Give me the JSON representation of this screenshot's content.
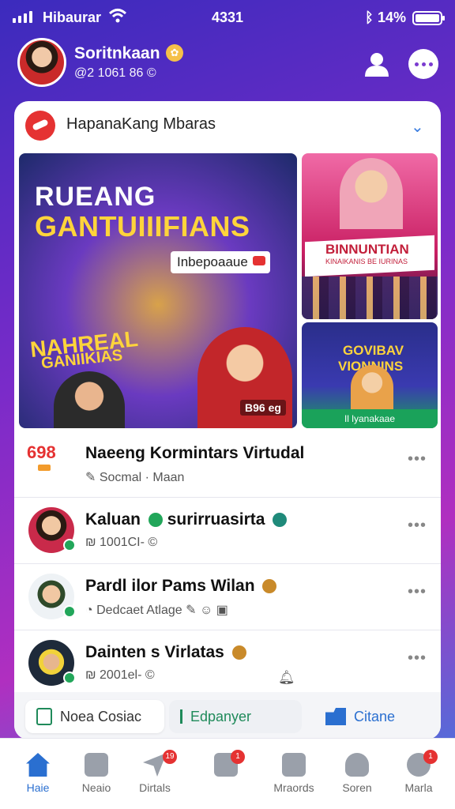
{
  "status": {
    "carrier": "Hibaurar",
    "time": "4331",
    "battery": "14%"
  },
  "profile": {
    "name": "Soritnkaan",
    "meta": "@2 1061 86 ©"
  },
  "card": {
    "title": "HapanaKang Mbaras"
  },
  "banners": {
    "main": {
      "line1": "RUEANG",
      "line2": "GANTUIIIFIANS",
      "pill": "Inbepoaaue",
      "sticker1": "NAHREAL",
      "sticker2": "GANIIKIAS",
      "tag": "B96 eg"
    },
    "top_right": {
      "title": "BINNUNTIAN",
      "subtitle": "KINAIKANIS BE IURINAS"
    },
    "bottom_right": {
      "line1": "GOVIBAV",
      "line2": "VIONNINS",
      "footer": "Il lyanakaae"
    }
  },
  "list": [
    {
      "name": "Naeeng Kormintars Virtudal",
      "meta": "Socmal · Maan",
      "logo": "698"
    },
    {
      "name": "Kaluan",
      "name_suffix": "surirruasirta",
      "meta": "1001CI- ©"
    },
    {
      "name": "Pardl ilor Pams Wilan",
      "meta": "Dedcaet  Atlage"
    },
    {
      "name": "Dainten s Virlatas",
      "meta": "2001el- ©"
    }
  ],
  "quick_actions": [
    {
      "label": "Noea Cosiac"
    },
    {
      "label": "Edpanyer"
    },
    {
      "label": "Citane"
    }
  ],
  "tabs": [
    {
      "label": "Haie"
    },
    {
      "label": "Neaio"
    },
    {
      "label": "Dirtals",
      "badge": "19"
    },
    {
      "label": "",
      "badge": "1"
    },
    {
      "label": "Mraords"
    },
    {
      "label": "Soren"
    },
    {
      "label": "Marla",
      "badge": "1"
    }
  ],
  "colors": {
    "accent": "#2a6fd0",
    "brand_red": "#e53232",
    "online": "#22a65a"
  }
}
